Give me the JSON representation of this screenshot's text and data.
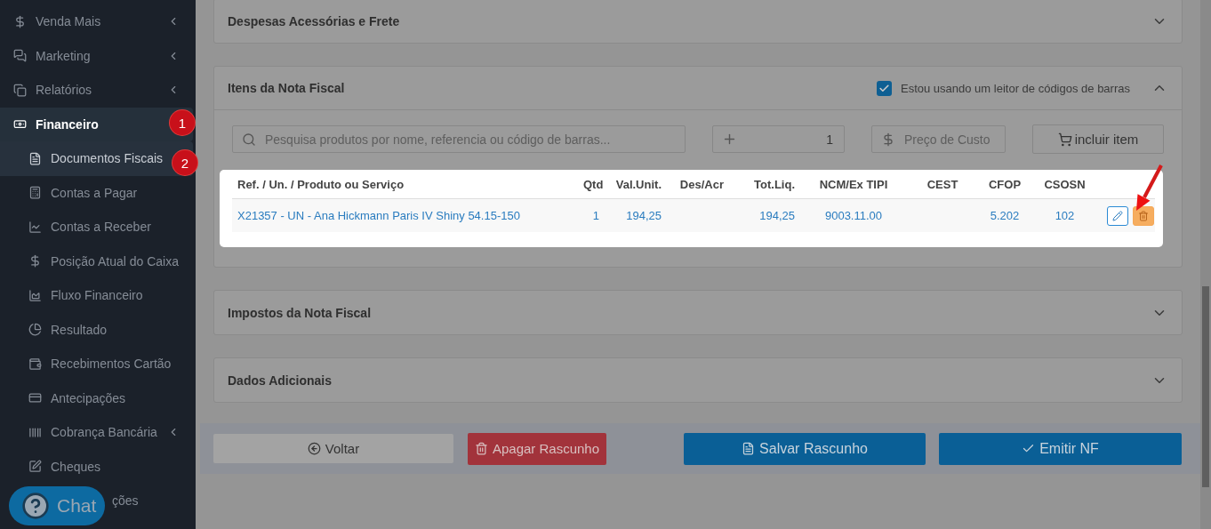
{
  "sidebar": {
    "items": [
      {
        "label": "Venda Mais",
        "selected": false,
        "collapsible": true
      },
      {
        "label": "Marketing",
        "selected": false,
        "collapsible": true
      },
      {
        "label": "Relatórios",
        "selected": false,
        "collapsible": true
      },
      {
        "label": "Financeiro",
        "selected": true,
        "collapsible": false,
        "children": [
          {
            "label": "Documentos Fiscais",
            "selected": true,
            "collapsible": false
          },
          {
            "label": "Contas a Pagar",
            "selected": false,
            "collapsible": false
          },
          {
            "label": "Contas a Receber",
            "selected": false,
            "collapsible": false
          },
          {
            "label": "Posição Atual do Caixa",
            "selected": false,
            "collapsible": false
          },
          {
            "label": "Fluxo Financeiro",
            "selected": false,
            "collapsible": false
          },
          {
            "label": "Resultado",
            "selected": false,
            "collapsible": false
          },
          {
            "label": "Recebimentos Cartão",
            "selected": false,
            "collapsible": false
          },
          {
            "label": "Antecipações",
            "selected": false,
            "collapsible": false
          },
          {
            "label": "Cobrança Bancária",
            "selected": false,
            "collapsible": true
          },
          {
            "label": "Cheques",
            "selected": false,
            "collapsible": false
          },
          {
            "label": "ções",
            "selected": false,
            "collapsible": false
          }
        ]
      }
    ]
  },
  "chat_button": {
    "label": "Chat"
  },
  "annotations": [
    "1",
    "2"
  ],
  "sections": [
    {
      "title": "Despesas Acessórias e Frete",
      "expanded": false
    },
    {
      "title": "Itens da Nota Fiscal",
      "expanded": true,
      "barcode_reader": {
        "label": "Estou usando um leitor de códigos de barras",
        "checked": true
      },
      "search": {
        "placeholder": "Pesquisa produtos por nome, referencia ou código de barras..."
      },
      "quantity": {
        "value": "1"
      },
      "price": {
        "placeholder": "Preço de Custo"
      },
      "add_button": "incluir item",
      "table": {
        "columns": [
          "Ref. / Un. / Produto ou Serviço",
          "Qtd",
          "Val.Unit.",
          "Des/Acr",
          "Tot.Liq.",
          "NCM/Ex TIPI",
          "CEST",
          "CFOP",
          "CSOSN"
        ],
        "rows": [
          [
            "X21357 - UN - Ana Hickmann Paris IV Shiny 54.15-150",
            "1",
            "194,25",
            "",
            "194,25",
            "9003.11.00",
            "",
            "5.202",
            "102"
          ]
        ]
      }
    },
    {
      "title": "Impostos da Nota Fiscal",
      "expanded": false
    },
    {
      "title": "Dados Adicionais",
      "expanded": false
    }
  ],
  "footer_buttons": [
    {
      "label": "Voltar",
      "kind": "back"
    },
    {
      "label": "Apagar Rascunho",
      "kind": "delete"
    },
    {
      "label": "Salvar Rascunho",
      "kind": "save"
    },
    {
      "label": "Emitir NF",
      "kind": "emit"
    }
  ]
}
